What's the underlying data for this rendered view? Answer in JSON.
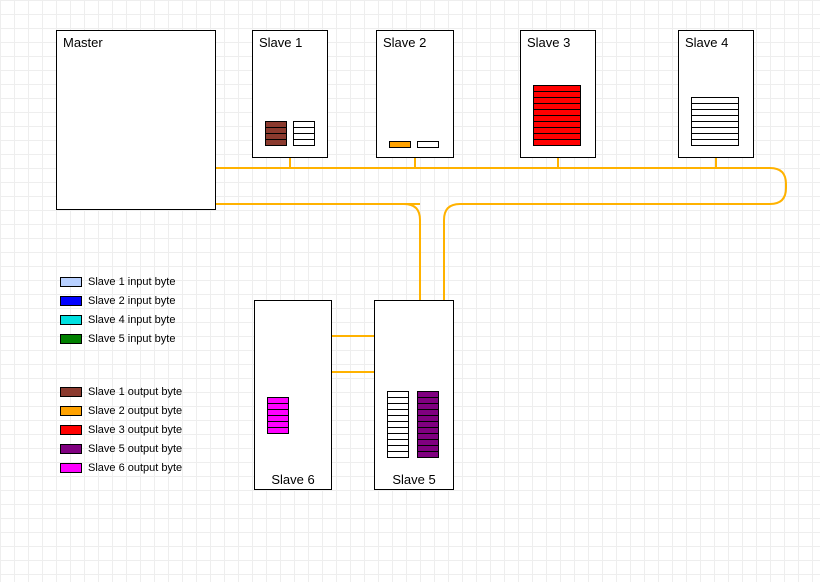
{
  "nodes": {
    "master": {
      "label": "Master"
    },
    "slave1": {
      "label": "Slave 1"
    },
    "slave2": {
      "label": "Slave 2"
    },
    "slave3": {
      "label": "Slave 3"
    },
    "slave4": {
      "label": "Slave 4"
    },
    "slave5": {
      "label": "Slave 5"
    },
    "slave6": {
      "label": "Slave 6"
    }
  },
  "stacks": {
    "slave1_out": {
      "color": "brown",
      "count": 4
    },
    "slave1_in": {
      "color": "empty",
      "count": 4
    },
    "slave2_out": {
      "color": "orange",
      "count": 1
    },
    "slave2_in": {
      "color": "empty",
      "count": 1
    },
    "slave3_out": {
      "color": "red",
      "count": 10
    },
    "slave4_in": {
      "color": "empty",
      "count": 8
    },
    "slave5_in": {
      "color": "empty",
      "count": 11
    },
    "slave5_out": {
      "color": "purple",
      "count": 11
    },
    "slave6_out": {
      "color": "magenta",
      "count": 6
    }
  },
  "legend": {
    "group1": [
      {
        "swatch": "lightblue",
        "label": "Slave 1 input byte"
      },
      {
        "swatch": "blue",
        "label": "Slave 2 input byte"
      },
      {
        "swatch": "cyan",
        "label": "Slave 4 input byte"
      },
      {
        "swatch": "green",
        "label": "Slave 5 input byte"
      }
    ],
    "group2": [
      {
        "swatch": "brown",
        "label": "Slave 1 output byte"
      },
      {
        "swatch": "orange",
        "label": "Slave 2 output byte"
      },
      {
        "swatch": "red",
        "label": "Slave 3 output byte"
      },
      {
        "swatch": "purple",
        "label": "Slave 5 output byte"
      },
      {
        "swatch": "magenta",
        "label": "Slave 6 output byte"
      }
    ]
  },
  "colors": {
    "wire": "#ffb200"
  }
}
